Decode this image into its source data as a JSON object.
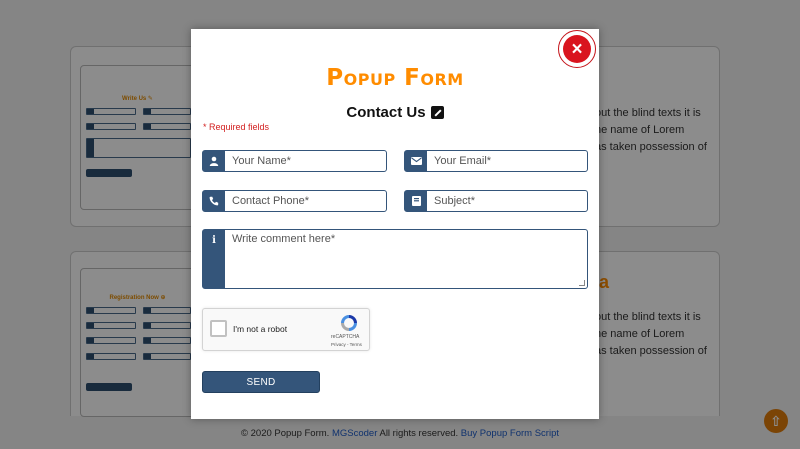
{
  "background": {
    "card1": {
      "thumb_title": "Write Us ✎",
      "heading": "",
      "lines": [
        "out the blind texts it is",
        "he name of Lorem",
        "as taken possession of"
      ]
    },
    "card2": {
      "thumb_title": "Registration Now ⊕",
      "heading": "a",
      "lines": [
        "out the blind texts it is",
        "he name of Lorem",
        "as taken possession of"
      ]
    }
  },
  "footer": {
    "copyright": "© 2020 Popup Form.",
    "author_link": "MGScoder",
    "rights": "All rights reserved.",
    "buy_link": "Buy Popup Form Script"
  },
  "scroll_top_icon": "arrow-up-circle-icon",
  "modal": {
    "close_icon": "×",
    "brand": "Popup Form",
    "title": "Contact Us",
    "required_note": "* Required fields",
    "fields": {
      "name": {
        "placeholder": "Your Name*",
        "value": "",
        "icon": "user-icon"
      },
      "email": {
        "placeholder": "Your Email*",
        "value": "",
        "icon": "envelope-icon"
      },
      "phone": {
        "placeholder": "Contact Phone*",
        "value": "",
        "icon": "phone-icon"
      },
      "subject": {
        "placeholder": "Subject*",
        "value": "",
        "icon": "book-icon"
      },
      "comment": {
        "placeholder": "Write comment here*",
        "value": "",
        "icon": "info-icon"
      }
    },
    "recaptcha": {
      "label": "I'm not a robot",
      "brand": "reCAPTCHA",
      "terms": "Privacy - Terms"
    },
    "send_label": "SEND"
  },
  "colors": {
    "accent_orange": "#ff8c00",
    "field_blue": "#34557a",
    "close_red": "#d9141e",
    "link_blue": "#1e5cc8"
  }
}
